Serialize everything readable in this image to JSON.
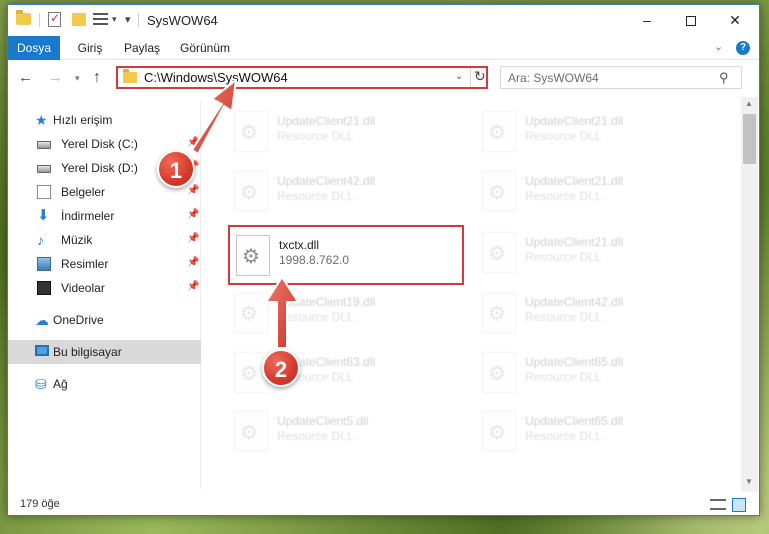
{
  "window": {
    "title": "SysWOW64",
    "minimize": "–",
    "close": "✕"
  },
  "ribbon": {
    "tabs": [
      "Dosya",
      "Giriş",
      "Paylaş",
      "Görünüm"
    ],
    "help": "?"
  },
  "navigation": {
    "address": "C:\\Windows\\SysWOW64",
    "search_placeholder": "Ara: SysWOW64"
  },
  "sidebar": {
    "items": [
      {
        "label": "Hızlı erişim",
        "icon": "star-icon"
      },
      {
        "label": "Yerel Disk (C:)",
        "icon": "drive-icon",
        "pinned": true
      },
      {
        "label": "Yerel Disk (D:)",
        "icon": "drive-icon",
        "pinned": true
      },
      {
        "label": "Belgeler",
        "icon": "documents-icon",
        "pinned": true
      },
      {
        "label": "İndirmeler",
        "icon": "downloads-icon",
        "pinned": true
      },
      {
        "label": "Müzik",
        "icon": "music-icon",
        "pinned": true
      },
      {
        "label": "Resimler",
        "icon": "pictures-icon",
        "pinned": true
      },
      {
        "label": "Videolar",
        "icon": "videos-icon",
        "pinned": true
      },
      {
        "label": "OneDrive",
        "icon": "cloud-icon"
      },
      {
        "label": "Bu bilgisayar",
        "icon": "computer-icon",
        "selected": true
      },
      {
        "label": "Ağ",
        "icon": "network-icon"
      }
    ]
  },
  "files": {
    "left": [
      {
        "name": "UpdateClient21.dll",
        "type": "Resource DLL"
      },
      {
        "name": "UpdateClient42.dll",
        "type": "Resource DLL"
      },
      {
        "name": "txctx.dll",
        "type": "1998.8.762.0"
      },
      {
        "name": "UpdateClient19.dll",
        "type": "Resource DLL"
      },
      {
        "name": "UpdateClient63.dll",
        "type": "Resource DLL"
      },
      {
        "name": "UpdateClient5.dll",
        "type": "Resource DLL"
      }
    ],
    "right": [
      {
        "name": "UpdateClient21.dll",
        "type": "Resource DLL"
      },
      {
        "name": "UpdateClient21.dll",
        "type": "Resource DLL"
      },
      {
        "name": "UpdateClient21.dll",
        "type": "Resource DLL"
      },
      {
        "name": "UpdateClient42.dll",
        "type": "Resource DLL"
      },
      {
        "name": "UpdateClient65.dll",
        "type": "Resource DLL"
      },
      {
        "name": "UpdateClient65.dll",
        "type": "Resource DLL"
      }
    ]
  },
  "status": {
    "item_count": "179 öğe"
  },
  "annotations": {
    "step1": "1",
    "step2": "2",
    "color": "#d23a3a"
  }
}
